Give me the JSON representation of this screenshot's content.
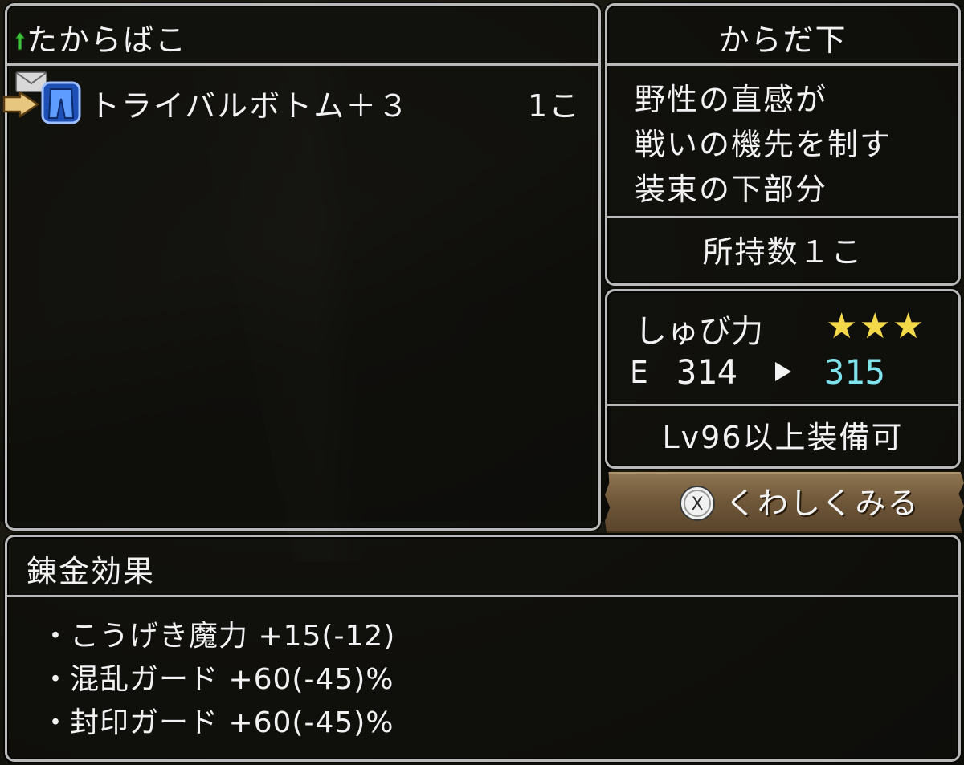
{
  "treasure_box": {
    "title": "たからばこ",
    "items": [
      {
        "name": "トライバルボトム＋３",
        "quantity": "1こ",
        "icon": "bottom-armor-icon"
      }
    ]
  },
  "item_detail": {
    "slot": "からだ下",
    "description": [
      "野性の直感が",
      "戦いの機先を制す",
      "装束の下部分"
    ],
    "owned": "所持数１こ",
    "stat": {
      "name": "しゅび力",
      "stars": "★★★",
      "rating": 3,
      "equip_marker": "E",
      "current": "314",
      "new": "315",
      "new_color": "#7fe3ee"
    },
    "requirement": "Lv96以上装備可"
  },
  "details_button": {
    "label": "くわしくみる",
    "button_glyph": "X"
  },
  "alchemy": {
    "title": "錬金効果",
    "effects": [
      "こうげき魔力 +15(-12)",
      "混乱ガード +60(-45)%",
      "封印ガード +60(-45)%"
    ]
  },
  "colors": {
    "frame": "#b9b9b9",
    "stars": "#f3d84a",
    "highlight": "#7fe3ee"
  }
}
